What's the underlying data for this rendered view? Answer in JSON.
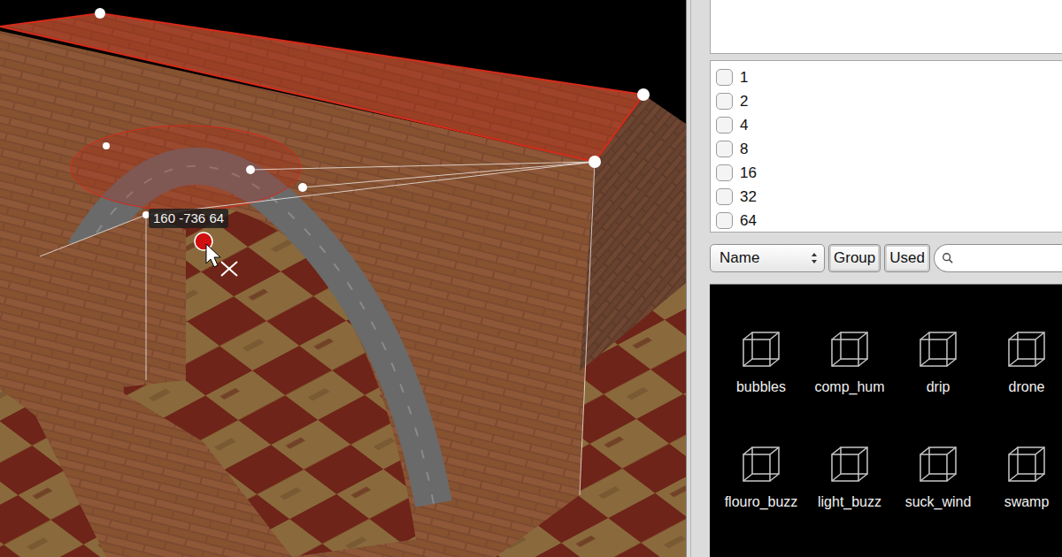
{
  "viewport": {
    "tooltip": "160 -736 64"
  },
  "flags": [
    {
      "label": "1",
      "checked": false
    },
    {
      "label": "2",
      "checked": false
    },
    {
      "label": "4",
      "checked": false
    },
    {
      "label": "8",
      "checked": false
    },
    {
      "label": "16",
      "checked": false
    },
    {
      "label": "32",
      "checked": false
    },
    {
      "label": "64",
      "checked": false
    }
  ],
  "browser": {
    "sort": "Name",
    "buttons": [
      {
        "label": "Group",
        "selected": false
      },
      {
        "label": "Used",
        "selected": false
      }
    ]
  },
  "entities": [
    {
      "label": "bubbles"
    },
    {
      "label": "comp_hum"
    },
    {
      "label": "drip"
    },
    {
      "label": "drone"
    },
    {
      "label": "flouro_buzz"
    },
    {
      "label": "light_buzz"
    },
    {
      "label": "suck_wind"
    },
    {
      "label": "swamp"
    }
  ]
}
